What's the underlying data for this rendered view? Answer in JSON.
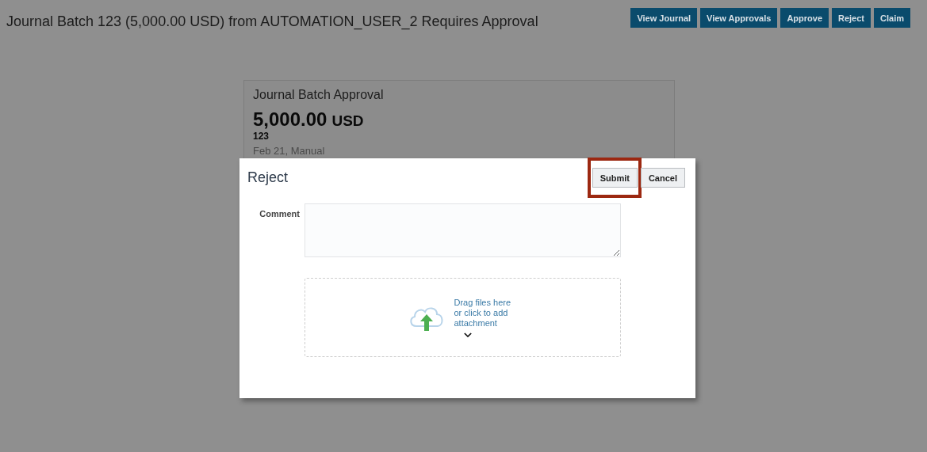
{
  "page_title": "Journal Batch 123 (5,000.00 USD) from AUTOMATION_USER_2 Requires Approval",
  "actions": [
    {
      "label": "View Journal"
    },
    {
      "label": "View Approvals"
    },
    {
      "label": "Approve"
    },
    {
      "label": "Reject"
    },
    {
      "label": "Claim"
    }
  ],
  "card": {
    "title": "Journal Batch Approval",
    "amount": "5,000.00",
    "currency": "USD",
    "batch": "123",
    "details": "Feb 21, Manual"
  },
  "dialog": {
    "title": "Reject",
    "buttons": [
      {
        "label": "Submit",
        "highlighted": true
      },
      {
        "label": "Cancel",
        "highlighted": false
      }
    ],
    "comment": {
      "label": "Comment"
    },
    "dropzone": {
      "text": "Drag files here or click to add attachment"
    }
  }
}
